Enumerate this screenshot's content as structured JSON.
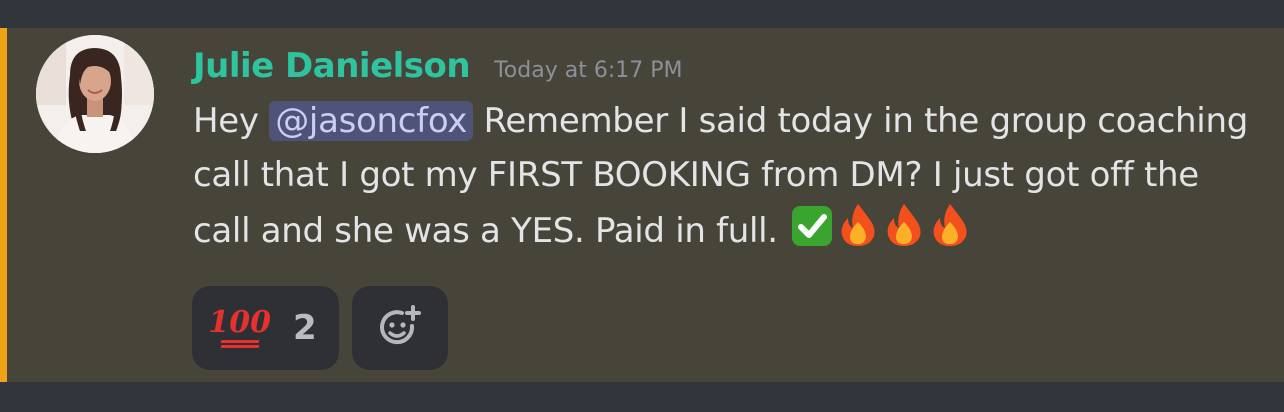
{
  "message": {
    "author": "Julie Danielson",
    "timestamp": "Today at 6:17 PM",
    "text_start": "Hey ",
    "mention": "@jasoncfox",
    "text_end": "  Remember I said today in the group coaching call that I got my FIRST BOOKING from DM? I just got off the call and she was a YES. Paid in full. ",
    "trailing_emojis": [
      "check-mark-emoji",
      "fire-emoji",
      "fire-emoji",
      "fire-emoji"
    ]
  },
  "reactions": [
    {
      "emoji": "hundred-points-emoji",
      "glyph": "100",
      "count": "2"
    }
  ],
  "add_reaction": {
    "icon": "add-reaction-icon"
  },
  "colors": {
    "author": "#2ec4a0",
    "highlight": "#f0a317",
    "mention_bg": "#4f5378",
    "message_bg": "#47443a"
  }
}
